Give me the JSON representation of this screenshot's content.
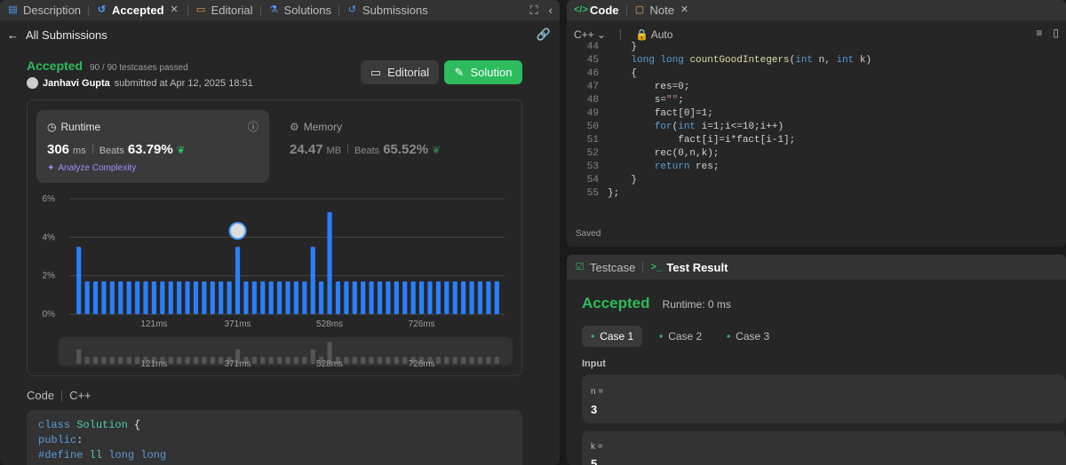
{
  "left_tabs": [
    {
      "label": "Description",
      "icon": "description-icon"
    },
    {
      "label": "Accepted",
      "icon": "history-icon"
    },
    {
      "label": "Editorial",
      "icon": "book-icon"
    },
    {
      "label": "Solutions",
      "icon": "flask-icon"
    },
    {
      "label": "Submissions",
      "icon": "history-icon"
    }
  ],
  "subheader": {
    "back_label": "All Submissions"
  },
  "result": {
    "status": "Accepted",
    "testcases": "90 / 90 testcases passed",
    "user": "Janhavi Gupta",
    "submitted": "submitted at Apr 12, 2025 18:51"
  },
  "buttons": {
    "editorial": "Editorial",
    "solution": "Solution"
  },
  "runtime": {
    "title": "Runtime",
    "value": "306",
    "unit": "ms",
    "beats_label": "Beats",
    "beats": "63.79%",
    "analyze": "Analyze Complexity"
  },
  "memory": {
    "title": "Memory",
    "value": "24.47",
    "unit": "MB",
    "beats_label": "Beats",
    "beats": "65.52%"
  },
  "chart_data": {
    "type": "bar",
    "ylabel": "",
    "xlabel": "",
    "y_ticks": [
      "6%",
      "4%",
      "2%",
      "0%"
    ],
    "ylim": [
      0,
      6
    ],
    "x_tick_labels": [
      "121ms",
      "371ms",
      "528ms",
      "726ms"
    ],
    "x_tick_indices": [
      9,
      19,
      30,
      41
    ],
    "values": [
      3.5,
      1.7,
      1.7,
      1.7,
      1.7,
      1.7,
      1.7,
      1.7,
      1.7,
      1.7,
      1.7,
      1.7,
      1.7,
      1.7,
      1.7,
      1.7,
      1.7,
      1.7,
      1.7,
      3.5,
      1.7,
      1.7,
      1.7,
      1.7,
      1.7,
      1.7,
      1.7,
      1.7,
      3.5,
      1.7,
      5.3,
      1.7,
      1.7,
      1.7,
      1.7,
      1.7,
      1.7,
      1.7,
      1.7,
      1.7,
      1.7,
      1.7,
      1.7,
      1.7,
      1.7,
      1.7,
      1.7,
      1.7,
      1.7,
      1.7,
      1.7
    ],
    "highlight_index": 19,
    "grid": true,
    "bar_color": "#2a7fff"
  },
  "code_section": {
    "label": "Code",
    "lang": "C++",
    "lines": [
      "class Solution {",
      "public:",
      "    #define ll long long"
    ]
  },
  "editor": {
    "tab_code": "Code",
    "tab_note": "Note",
    "lang": "C++",
    "mode": "Auto",
    "saved": "Saved",
    "line_numbers": [
      "44",
      "45",
      "46",
      "47",
      "48",
      "49",
      "50",
      "51",
      "52",
      "53",
      "54",
      "55"
    ]
  },
  "test": {
    "tab_testcase": "Testcase",
    "tab_result": "Test Result",
    "status": "Accepted",
    "runtime": "Runtime: 0 ms",
    "cases": [
      "Case 1",
      "Case 2",
      "Case 3"
    ],
    "input_label": "Input",
    "n_label": "n =",
    "n_value": "3",
    "k_label": "k =",
    "k_value": "5"
  }
}
